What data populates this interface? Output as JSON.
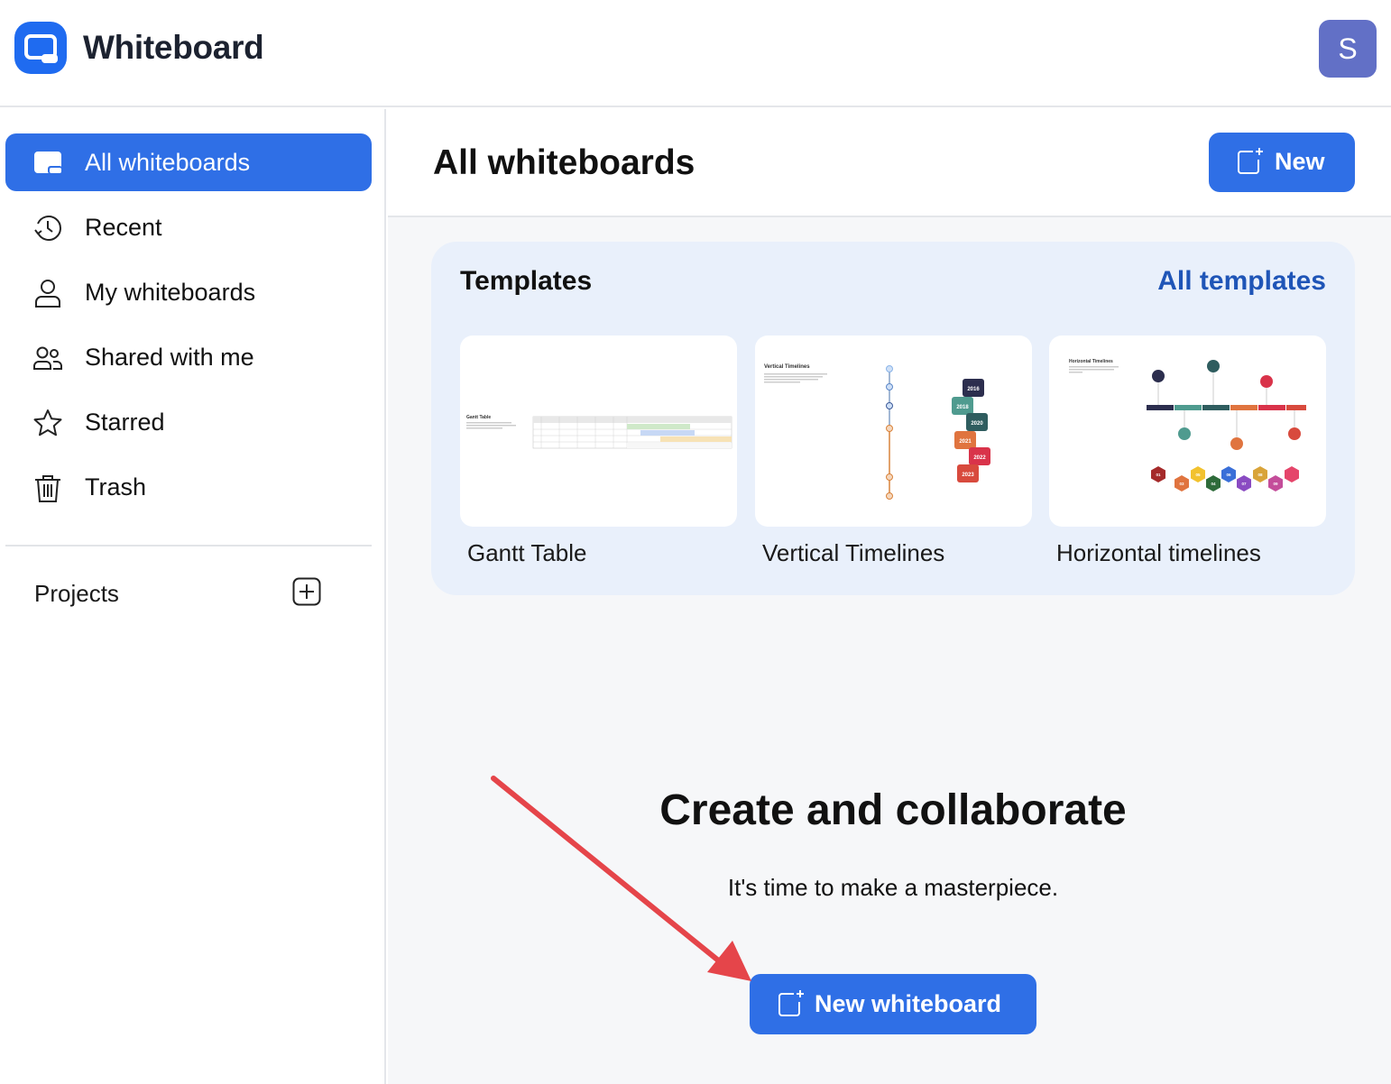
{
  "app": {
    "title": "Whiteboard",
    "avatar_initial": "S"
  },
  "sidebar": {
    "items": [
      {
        "label": "All whiteboards",
        "icon": "whiteboard-icon",
        "active": true
      },
      {
        "label": "Recent",
        "icon": "clock-icon",
        "active": false
      },
      {
        "label": "My whiteboards",
        "icon": "user-icon",
        "active": false
      },
      {
        "label": "Shared with me",
        "icon": "users-icon",
        "active": false
      },
      {
        "label": "Starred",
        "icon": "star-icon",
        "active": false
      },
      {
        "label": "Trash",
        "icon": "trash-icon",
        "active": false
      }
    ],
    "projects_label": "Projects"
  },
  "main": {
    "title": "All whiteboards",
    "new_button": "New",
    "templates": {
      "title": "Templates",
      "all_link": "All templates",
      "cards": [
        {
          "label": "Gantt Table",
          "thumb_title": "Gantt Table"
        },
        {
          "label": "Vertical Timelines",
          "thumb_title": "Vertical Timelines",
          "years": [
            "2016",
            "2018",
            "2020",
            "2021",
            "2022",
            "2023"
          ]
        },
        {
          "label": "Horizontal timelines",
          "thumb_title": "Horizontal Timelines",
          "nodes": [
            "01",
            "03",
            "05",
            "04",
            "06",
            "07",
            "08",
            "09"
          ]
        }
      ]
    },
    "empty_state": {
      "title": "Create and collaborate",
      "subtitle": "It's time to make a masterpiece.",
      "button": "New whiteboard"
    }
  },
  "colors": {
    "accent": "#2f6fe6",
    "link": "#1f55b7",
    "avatar": "#6270c6",
    "annotation_arrow": "#e5454a"
  }
}
